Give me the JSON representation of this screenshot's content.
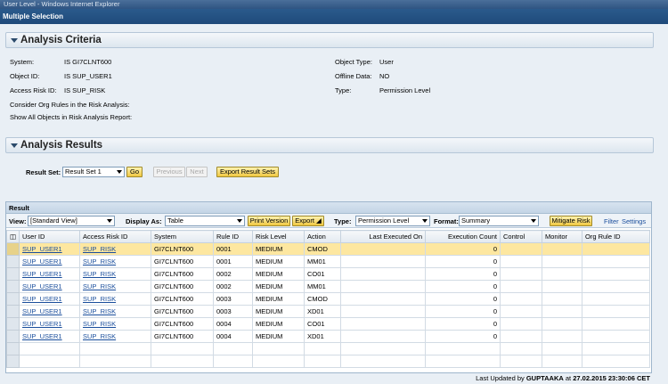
{
  "window": {
    "title": "User Level - Windows Internet Explorer"
  },
  "app": {
    "header": "Multiple Selection"
  },
  "criteria": {
    "title": "Analysis Criteria",
    "left": [
      {
        "label": "System:",
        "value": "IS GI7CLNT600"
      },
      {
        "label": "Object ID:",
        "value": "IS SUP_USER1"
      },
      {
        "label": "Access Risk ID:",
        "value": "IS SUP_RISK"
      }
    ],
    "right": [
      {
        "label": "Object Type:",
        "value": "User"
      },
      {
        "label": "Offline Data:",
        "value": "NO"
      },
      {
        "label": "Type:",
        "value": "Permission Level"
      }
    ],
    "org_rules": "Consider Org Rules in the Risk Analysis:",
    "show_all": "Show All Objects in Risk Analysis Report:"
  },
  "results": {
    "title": "Analysis Results",
    "result_set_label": "Result Set:",
    "result_set_value": "Result Set 1",
    "go": "Go",
    "previous": "Previous",
    "next": "Next",
    "export_sets": "Export Result Sets"
  },
  "result_panel": {
    "title": "Result",
    "view_label": "View:",
    "view_value": "[Standard View]",
    "display_label": "Display As:",
    "display_value": "Table",
    "print": "Print Version",
    "export": "Export ◢",
    "type_label": "Type:",
    "type_value": "Permission Level",
    "format_label": "Format:",
    "format_value": "Summary",
    "mitigate": "Mitigate Risk",
    "filter": "Filter",
    "settings": "Settings"
  },
  "table": {
    "columns": [
      "User ID",
      "Access Risk ID",
      "System",
      "Rule ID",
      "Risk Level",
      "Action",
      "Last Executed On",
      "Execution Count",
      "Control",
      "Monitor",
      "Org Rule ID"
    ],
    "rows": [
      [
        "SUP_USER1",
        "SUP_RISK",
        "GI7CLNT600",
        "0001",
        "MEDIUM",
        "CMOD",
        "",
        "0",
        "",
        "",
        ""
      ],
      [
        "SUP_USER1",
        "SUP_RISK",
        "GI7CLNT600",
        "0001",
        "MEDIUM",
        "MM01",
        "",
        "0",
        "",
        "",
        ""
      ],
      [
        "SUP_USER1",
        "SUP_RISK",
        "GI7CLNT600",
        "0002",
        "MEDIUM",
        "CO01",
        "",
        "0",
        "",
        "",
        ""
      ],
      [
        "SUP_USER1",
        "SUP_RISK",
        "GI7CLNT600",
        "0002",
        "MEDIUM",
        "MM01",
        "",
        "0",
        "",
        "",
        ""
      ],
      [
        "SUP_USER1",
        "SUP_RISK",
        "GI7CLNT600",
        "0003",
        "MEDIUM",
        "CMOD",
        "",
        "0",
        "",
        "",
        ""
      ],
      [
        "SUP_USER1",
        "SUP_RISK",
        "GI7CLNT600",
        "0003",
        "MEDIUM",
        "XD01",
        "",
        "0",
        "",
        "",
        ""
      ],
      [
        "SUP_USER1",
        "SUP_RISK",
        "GI7CLNT600",
        "0004",
        "MEDIUM",
        "CO01",
        "",
        "0",
        "",
        "",
        ""
      ],
      [
        "SUP_USER1",
        "SUP_RISK",
        "GI7CLNT600",
        "0004",
        "MEDIUM",
        "XD01",
        "",
        "0",
        "",
        "",
        ""
      ]
    ]
  },
  "footer": {
    "prefix": "Last Updated by",
    "user": "GUPTAAKA",
    "at": "at",
    "timestamp": "27.02.2015 23:30:06",
    "tz": "CET"
  },
  "colors": {
    "accent_bar": "#1f4a7a",
    "highlight_row": "#fde7a0",
    "button": "#f0c840"
  }
}
